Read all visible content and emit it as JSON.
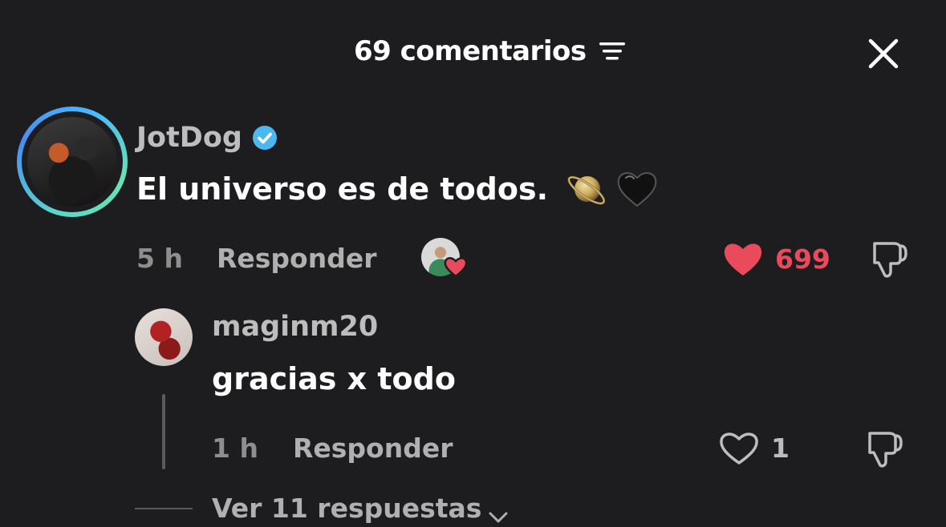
{
  "header": {
    "title": "69 comentarios",
    "sort_icon": "sort-icon",
    "close_icon": "close-icon"
  },
  "comments": [
    {
      "username": "JotDog",
      "verified": true,
      "text": "El universo es de todos.",
      "emojis": [
        "planet-icon",
        "black-heart-icon"
      ],
      "time": "5 h",
      "reply_label": "Responder",
      "liked_by_creator": true,
      "likes": "699",
      "liked": true,
      "colors": {
        "like": "#e94a5c",
        "verified": "#4cb8f0",
        "avatar_ring": "#4ab7ff"
      }
    },
    {
      "username": "maginm20",
      "text": "gracias x todo",
      "time": "1 h",
      "reply_label": "Responder",
      "likes": "1",
      "liked": false
    }
  ],
  "view_replies": {
    "label": "Ver 11 respuestas"
  }
}
